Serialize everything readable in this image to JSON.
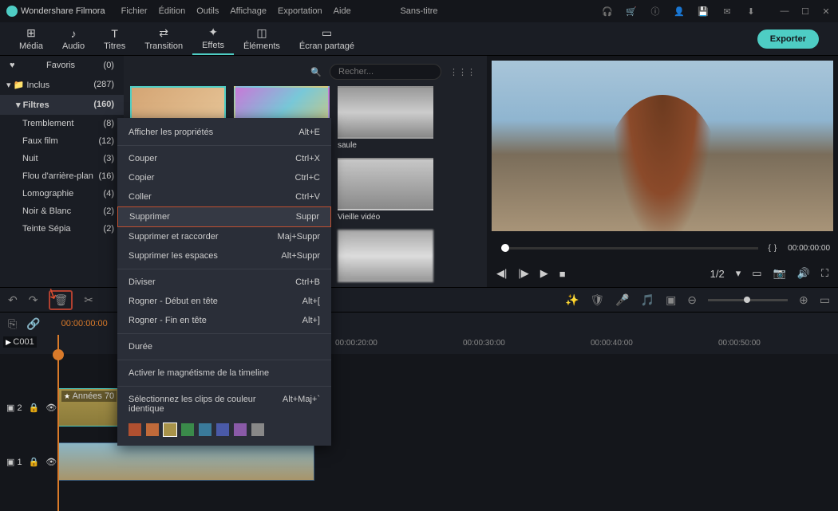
{
  "app": {
    "name": "Wondershare Filmora",
    "project": "Sans-titre"
  },
  "menus": [
    "Fichier",
    "Édition",
    "Outils",
    "Affichage",
    "Exportation",
    "Aide"
  ],
  "tabs": [
    {
      "icon": "⊞",
      "label": "Média"
    },
    {
      "icon": "♪",
      "label": "Audio"
    },
    {
      "icon": "T",
      "label": "Titres"
    },
    {
      "icon": "⇄",
      "label": "Transition"
    },
    {
      "icon": "✦",
      "label": "Effets"
    },
    {
      "icon": "◫",
      "label": "Éléments"
    },
    {
      "icon": "▭",
      "label": "Écran partagé"
    }
  ],
  "export": "Exporter",
  "sidebar": {
    "favoris": {
      "label": "Favoris",
      "count": "(0)"
    },
    "inclus": {
      "label": "Inclus",
      "count": "(287)"
    },
    "filtres": {
      "label": "Filtres",
      "count": "(160)"
    },
    "subs": [
      {
        "label": "Tremblement",
        "count": "(8)"
      },
      {
        "label": "Faux film",
        "count": "(12)"
      },
      {
        "label": "Nuit",
        "count": "(3)"
      },
      {
        "label": "Flou d'arrière-plan",
        "count": "(16)"
      },
      {
        "label": "Lomographie",
        "count": "(4)"
      },
      {
        "label": "Noir & Blanc",
        "count": "(2)"
      },
      {
        "label": "Teinte Sépia",
        "count": "(2)"
      }
    ]
  },
  "search": {
    "placeholder": "Recher..."
  },
  "thumbs": {
    "saule": "saule",
    "vieille": "Vieille vidéo"
  },
  "ctx": [
    {
      "label": "Afficher les propriétés",
      "sc": "Alt+E"
    },
    {
      "sep": true
    },
    {
      "label": "Couper",
      "sc": "Ctrl+X"
    },
    {
      "label": "Copier",
      "sc": "Ctrl+C"
    },
    {
      "label": "Coller",
      "sc": "Ctrl+V",
      "disabled": true
    },
    {
      "label": "Supprimer",
      "sc": "Suppr",
      "hi": true
    },
    {
      "label": "Supprimer et raccorder",
      "sc": "Maj+Suppr"
    },
    {
      "label": "Supprimer les espaces",
      "sc": "Alt+Suppr",
      "disabled": true
    },
    {
      "sep": true
    },
    {
      "label": "Diviser",
      "sc": "Ctrl+B",
      "disabled": true
    },
    {
      "label": "Rogner - Début en tête",
      "sc": "Alt+[",
      "disabled": true
    },
    {
      "label": "Rogner - Fin en tête",
      "sc": "Alt+]",
      "disabled": true
    },
    {
      "sep": true
    },
    {
      "label": "Durée",
      "sc": ""
    },
    {
      "sep": true
    },
    {
      "label": "Activer le magnétisme de la timeline",
      "sc": ""
    },
    {
      "sep": true
    },
    {
      "label": "Sélectionnez les clips de couleur identique",
      "sc": "Alt+Maj+`"
    }
  ],
  "colors": [
    "#b05030",
    "#c06a3a",
    "#a8934a",
    "#3a8a4a",
    "#3a7a9a",
    "#4a5aa8",
    "#8a5aa8",
    "#888"
  ],
  "preview": {
    "time_l": "{",
    "time_r": "}",
    "time": "00:00:00:00",
    "ratio": "1/2"
  },
  "timeline": {
    "tc_main": "00:00:00:00",
    "ticks": [
      "00:00:20:00",
      "00:00:30:00",
      "00:00:40:00",
      "00:00:50:00"
    ],
    "fx_clip": "Années 70",
    "vid_clip": "C001",
    "tracks": {
      "fx": "2",
      "vid": "1"
    }
  }
}
